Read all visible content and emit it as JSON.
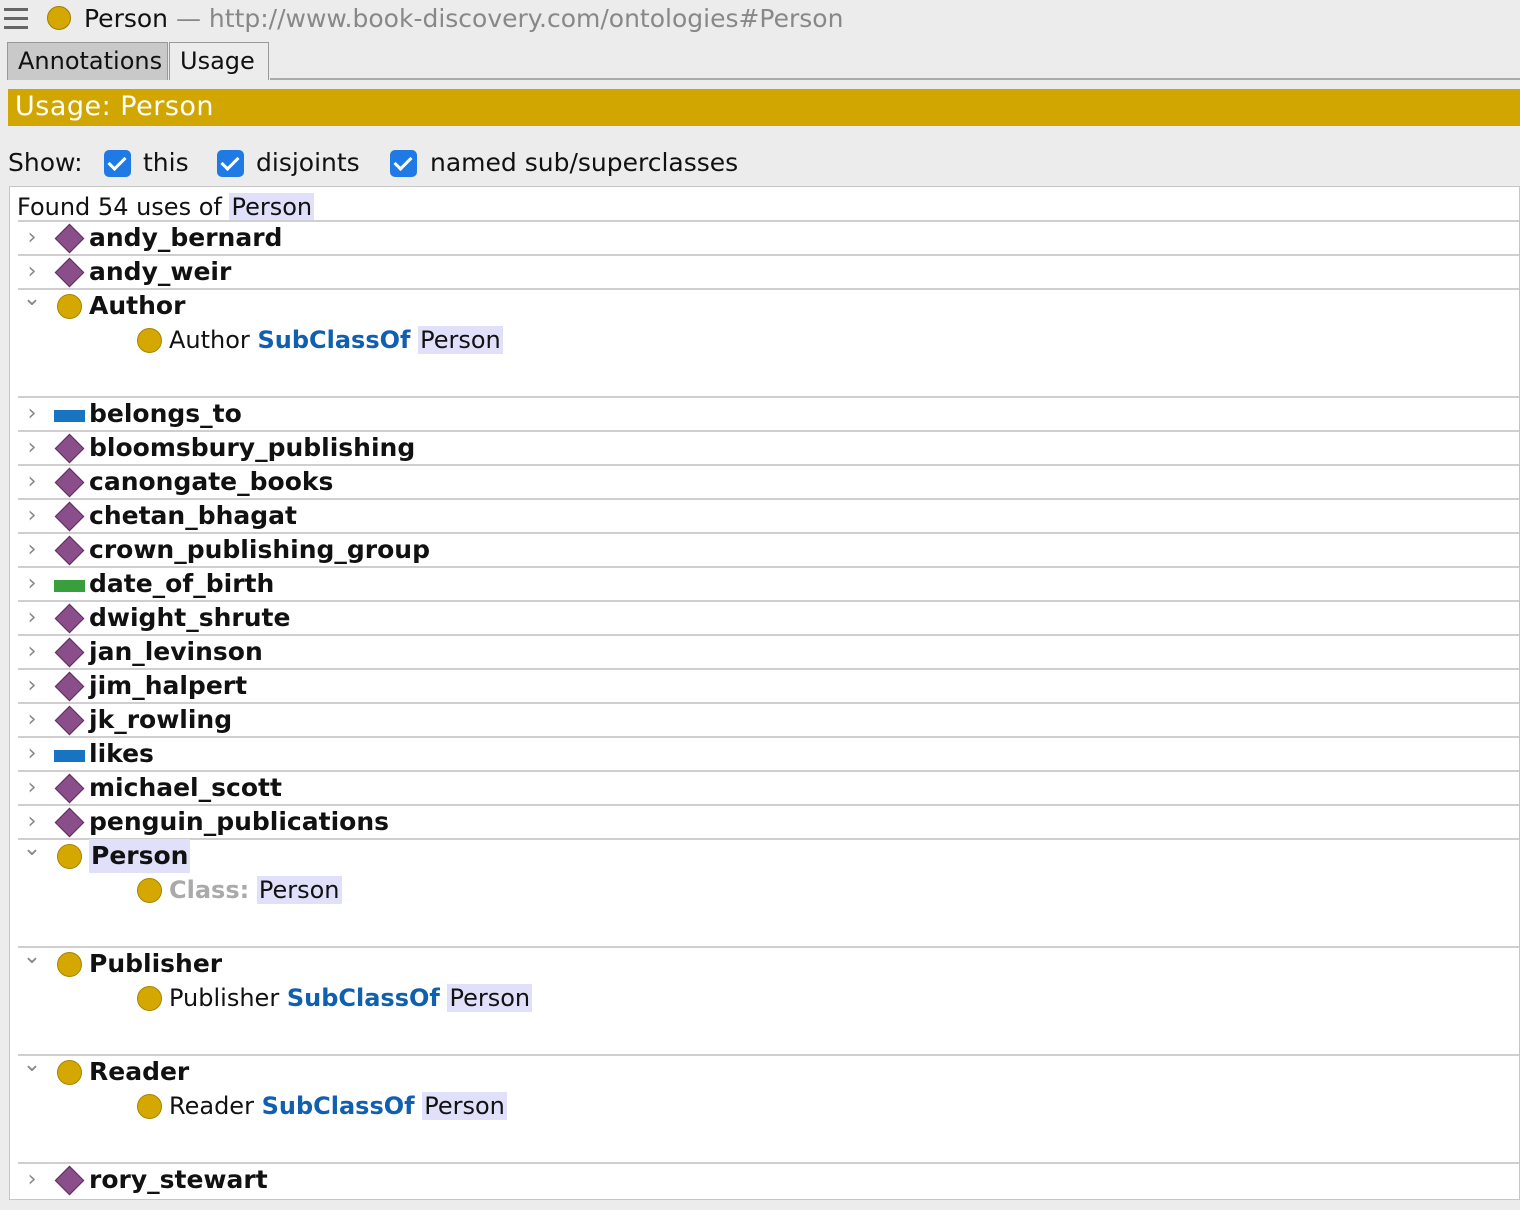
{
  "window": {
    "entity_name": "Person",
    "separator": " — ",
    "entity_iri": "http://www.book-discovery.com/ontologies#Person"
  },
  "tabs": [
    {
      "label": "Annotations",
      "selected": false
    },
    {
      "label": "Usage",
      "selected": true
    }
  ],
  "header": {
    "title": "Usage: Person"
  },
  "show": {
    "label": "Show:",
    "options": [
      {
        "label": "this",
        "checked": true
      },
      {
        "label": "disjoints",
        "checked": true
      },
      {
        "label": "named sub/superclasses",
        "checked": true
      }
    ]
  },
  "usage": {
    "found_prefix": "Found 54 uses of",
    "found_entity": "Person",
    "items": [
      {
        "label": "andy_bernard",
        "type": "individual",
        "expanded": false
      },
      {
        "label": "andy_weir",
        "type": "individual",
        "expanded": false
      },
      {
        "label": "Author",
        "type": "class",
        "expanded": true,
        "axiom": {
          "subject": "Author",
          "keyword": "SubClassOf",
          "object": "Person"
        }
      },
      {
        "label": "belongs_to",
        "type": "object-property",
        "expanded": false
      },
      {
        "label": "bloomsbury_publishing",
        "type": "individual",
        "expanded": false
      },
      {
        "label": "canongate_books",
        "type": "individual",
        "expanded": false
      },
      {
        "label": "chetan_bhagat",
        "type": "individual",
        "expanded": false
      },
      {
        "label": "crown_publishing_group",
        "type": "individual",
        "expanded": false
      },
      {
        "label": "date_of_birth",
        "type": "data-property",
        "expanded": false
      },
      {
        "label": "dwight_shrute",
        "type": "individual",
        "expanded": false
      },
      {
        "label": "jan_levinson",
        "type": "individual",
        "expanded": false
      },
      {
        "label": "jim_halpert",
        "type": "individual",
        "expanded": false
      },
      {
        "label": "jk_rowling",
        "type": "individual",
        "expanded": false
      },
      {
        "label": "likes",
        "type": "object-property",
        "expanded": false
      },
      {
        "label": "michael_scott",
        "type": "individual",
        "expanded": false
      },
      {
        "label": "penguin_publications",
        "type": "individual",
        "expanded": false
      },
      {
        "label": "Person",
        "type": "class",
        "expanded": true,
        "axiom": {
          "subject": "",
          "keyword": "Class:",
          "object": "Person"
        }
      },
      {
        "label": "Publisher",
        "type": "class",
        "expanded": true,
        "axiom": {
          "subject": "Publisher",
          "keyword": "SubClassOf",
          "object": "Person"
        }
      },
      {
        "label": "Reader",
        "type": "class",
        "expanded": true,
        "axiom": {
          "subject": "Reader",
          "keyword": "SubClassOf",
          "object": "Person"
        }
      },
      {
        "label": "rory_stewart",
        "type": "individual",
        "expanded": false
      }
    ]
  },
  "colors": {
    "class": "#d4a800",
    "individual": "#8a4f8a",
    "object-property": "#1874c0",
    "data-property": "#37a03c",
    "header": "#d1a600",
    "keyword": "#1160b0"
  }
}
